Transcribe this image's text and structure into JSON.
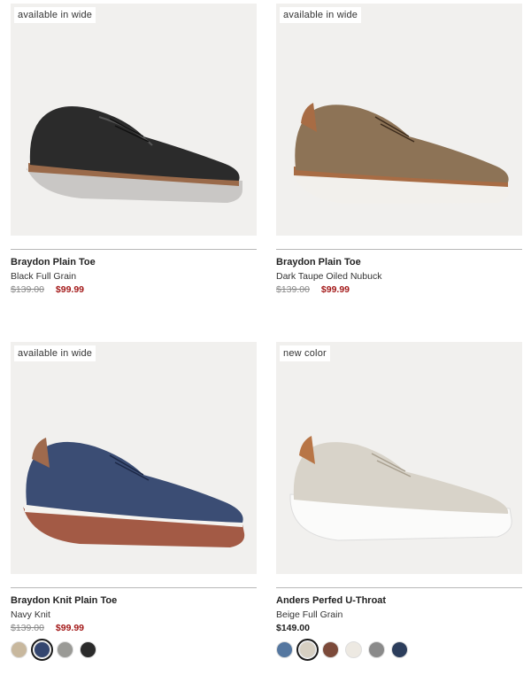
{
  "products": [
    {
      "badge": "available in wide",
      "name": "Braydon Plain Toe",
      "color": "Black Full Grain",
      "price_original": "$139.00",
      "price_sale": "$99.99",
      "shoe_colors": {
        "upper": "#2b2b2b",
        "sole": "#c9c7c5",
        "welt": "#9a6a4a"
      },
      "swatches": []
    },
    {
      "badge": "available in wide",
      "name": "Braydon Plain Toe",
      "color": "Dark Taupe Oiled Nubuck",
      "price_original": "$139.00",
      "price_sale": "$99.99",
      "shoe_colors": {
        "upper": "#8d7356",
        "sole": "#f2f0ec",
        "welt": "#a86c44"
      },
      "swatches": []
    },
    {
      "badge": "available in wide",
      "name": "Braydon Knit Plain Toe",
      "color": "Navy Knit",
      "price_original": "$139.00",
      "price_sale": "$99.99",
      "shoe_colors": {
        "upper": "#3b4d74",
        "sole": "#a35a45",
        "welt": "#9f6a4d"
      },
      "swatches": [
        {
          "name": "beige-knit-swatch",
          "color": "#c8b89e",
          "selected": false
        },
        {
          "name": "navy-knit-swatch",
          "color": "#34466f",
          "selected": true
        },
        {
          "name": "grey-knit-swatch",
          "color": "#9a9a96",
          "selected": false
        },
        {
          "name": "black-knit-swatch",
          "color": "#2a2a2a",
          "selected": false
        }
      ]
    },
    {
      "badge": "new color",
      "name": "Anders Perfed U-Throat",
      "color": "Beige Full Grain",
      "price_regular": "$149.00",
      "shoe_colors": {
        "upper": "#d8d3c9",
        "sole": "#fbfbfa",
        "welt": "#b87546"
      },
      "swatches": [
        {
          "name": "blue-swatch",
          "color": "#5577a0",
          "selected": false
        },
        {
          "name": "beige-swatch",
          "color": "#d6cfc2",
          "selected": true
        },
        {
          "name": "brown-swatch",
          "color": "#7c4a3a",
          "selected": false
        },
        {
          "name": "white-swatch",
          "color": "#ede9e2",
          "selected": false
        },
        {
          "name": "grey-swatch",
          "color": "#8a8a8a",
          "selected": false
        },
        {
          "name": "navy-swatch",
          "color": "#2c3e5c",
          "selected": false
        }
      ]
    }
  ]
}
